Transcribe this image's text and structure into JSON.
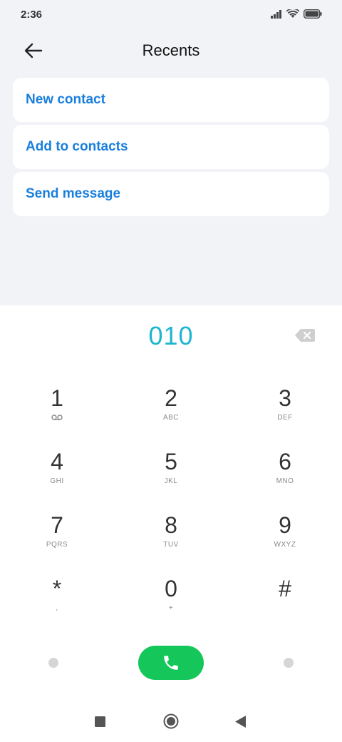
{
  "status_bar": {
    "time": "2:36"
  },
  "header": {
    "title": "Recents"
  },
  "actions": [
    {
      "label": "New contact"
    },
    {
      "label": "Add to contacts"
    },
    {
      "label": "Send message"
    }
  ],
  "dialer": {
    "number": "010",
    "keys": [
      {
        "digit": "1",
        "letters": ""
      },
      {
        "digit": "2",
        "letters": "ABC"
      },
      {
        "digit": "3",
        "letters": "DEF"
      },
      {
        "digit": "4",
        "letters": "GHI"
      },
      {
        "digit": "5",
        "letters": "JKL"
      },
      {
        "digit": "6",
        "letters": "MNO"
      },
      {
        "digit": "7",
        "letters": "PQRS"
      },
      {
        "digit": "8",
        "letters": "TUV"
      },
      {
        "digit": "9",
        "letters": "WXYZ"
      },
      {
        "digit": "*",
        "letters": ","
      },
      {
        "digit": "0",
        "letters": "+"
      },
      {
        "digit": "#",
        "letters": ""
      }
    ]
  },
  "colors": {
    "accent": "#1a7fdc",
    "number": "#1bb6cf",
    "call": "#15c75a",
    "background": "#f2f3f7"
  },
  "icons": [
    "back-arrow-icon",
    "backspace-icon",
    "voicemail-icon",
    "phone-icon",
    "signal-icon",
    "wifi-icon",
    "battery-icon",
    "recents-nav-icon",
    "home-nav-icon",
    "back-nav-icon"
  ]
}
